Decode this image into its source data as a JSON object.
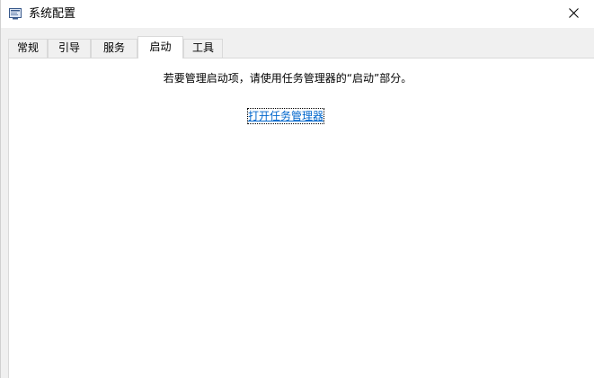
{
  "window": {
    "title": "系统配置",
    "icon": "msconfig-app-icon",
    "close_icon": "close-icon"
  },
  "tabs": [
    {
      "label": "常规",
      "active": false
    },
    {
      "label": "引导",
      "active": false
    },
    {
      "label": "服务",
      "active": false
    },
    {
      "label": "启动",
      "active": true
    },
    {
      "label": "工具",
      "active": false
    }
  ],
  "startup": {
    "message": "若要管理启动项，请使用任务管理器的“启动”部分。",
    "link_label": "打开任务管理器"
  },
  "colors": {
    "link": "#0066cc",
    "panel": "#ffffff",
    "background": "#f0f0f0"
  }
}
